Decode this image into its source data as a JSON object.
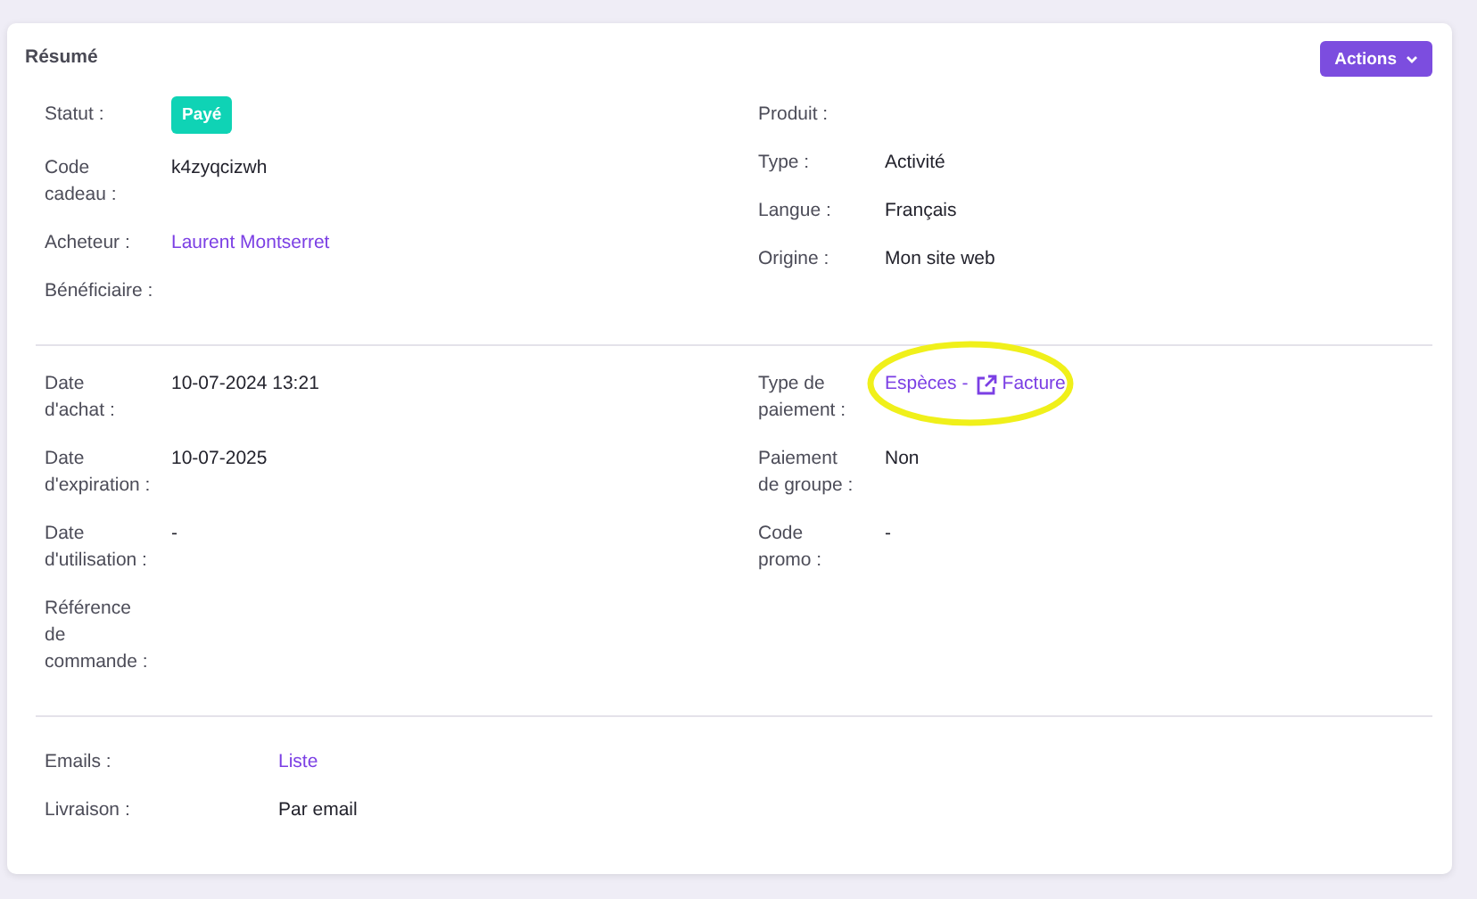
{
  "card": {
    "title": "Résumé",
    "actions_button": "Actions"
  },
  "sections": [
    {
      "left": [
        {
          "label": "Statut :",
          "kind": "badge",
          "value": "Payé"
        },
        {
          "label": "Code\ncadeau :",
          "kind": "text",
          "value": "k4zyqcizwh"
        },
        {
          "label": "Acheteur :",
          "kind": "link",
          "value": "Laurent Montserret"
        },
        {
          "label": "Bénéficiaire :",
          "kind": "none"
        }
      ],
      "right": [
        {
          "label": "Produit :",
          "kind": "none"
        },
        {
          "label": "Type :",
          "kind": "text",
          "value": "Activité"
        },
        {
          "label": "Langue :",
          "kind": "text",
          "value": "Français"
        },
        {
          "label": "Origine :",
          "kind": "text",
          "value": "Mon site web"
        }
      ]
    },
    {
      "left": [
        {
          "label": "Date\nd'achat :",
          "kind": "text",
          "value": "10-07-2024 13:21"
        },
        {
          "label": "Date\nd'expiration :",
          "kind": "text",
          "value": "10-07-2025"
        },
        {
          "label": "Date\nd'utilisation :",
          "kind": "text",
          "value": "-"
        },
        {
          "label": "Référence\nde\ncommande :",
          "kind": "none"
        }
      ],
      "right": [
        {
          "label": "Type de\npaiement :",
          "kind": "payment",
          "value": "Espèces",
          "separator": "-",
          "link": "Facture",
          "highlighted": true
        },
        {
          "label": "Paiement\nde groupe :",
          "kind": "text",
          "value": "Non"
        },
        {
          "label": "Code\npromo :",
          "kind": "text",
          "value": "-"
        }
      ]
    }
  ],
  "footer": [
    {
      "label": "Emails :",
      "kind": "link",
      "value": "Liste"
    },
    {
      "label": "Livraison :",
      "kind": "text",
      "value": "Par email"
    }
  ]
}
